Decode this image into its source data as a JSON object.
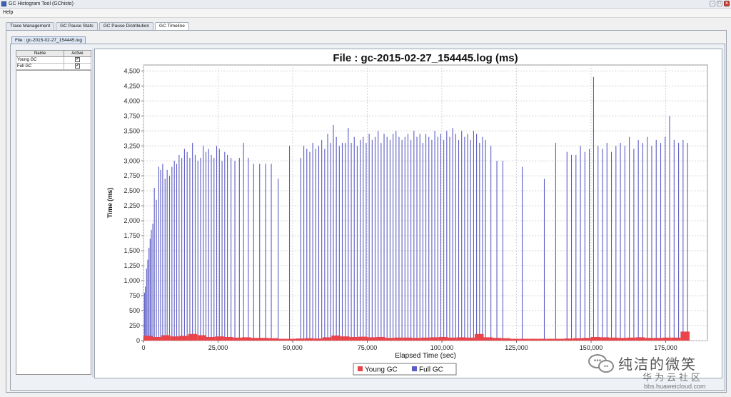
{
  "window": {
    "title": "GC Histogram Tool (GChisto)",
    "min": "–",
    "max": "□",
    "close": "✕"
  },
  "menu": {
    "help": "Help"
  },
  "tabs": [
    {
      "label": "Trace Management"
    },
    {
      "label": "GC Pause Stats"
    },
    {
      "label": "GC Pause Distribution"
    },
    {
      "label": "GC Timeline",
      "active": true
    }
  ],
  "file_tab": "File : gc-2015-02-27_154445.log",
  "series_table": {
    "headers": [
      "Name",
      "Active"
    ],
    "rows": [
      {
        "name": "Young GC",
        "active": true,
        "check": "✔"
      },
      {
        "name": "Full GC",
        "active": true,
        "check": "✔"
      }
    ]
  },
  "colors": {
    "young": "#e8444a",
    "full": "#5b5bc4",
    "grid": "#c0c0c0",
    "plot_bg": "#ffffff"
  },
  "chart_data": {
    "type": "bar",
    "title": "File : gc-2015-02-27_154445.log (ms)",
    "xlabel": "Elapsed Time (sec)",
    "ylabel": "Time (ms)",
    "xlim": [
      0,
      189000
    ],
    "ylim": [
      0,
      4600
    ],
    "x_ticks": [
      0,
      25000,
      50000,
      75000,
      100000,
      125000,
      150000,
      175000
    ],
    "x_tick_labels": [
      "0",
      "25,000",
      "50,000",
      "75,000",
      "100,000",
      "125,000",
      "150,000",
      "175,000"
    ],
    "y_ticks": [
      0,
      250,
      500,
      750,
      1000,
      1250,
      1500,
      1750,
      2000,
      2250,
      2500,
      2750,
      3000,
      3250,
      3500,
      3750,
      4000,
      4250,
      4500
    ],
    "y_tick_labels": [
      "0",
      "250",
      "500",
      "750",
      "1,000",
      "1,250",
      "1,500",
      "1,750",
      "2,000",
      "2,250",
      "2,500",
      "2,750",
      "3,000",
      "3,250",
      "3,500",
      "3,750",
      "4,000",
      "4,250",
      "4,500"
    ],
    "grid": true,
    "legend": "bottom-center",
    "series": [
      {
        "name": "Full GC",
        "color": "#5b5bc4",
        "x": [
          200,
          500,
          900,
          1300,
          1700,
          2100,
          2500,
          3000,
          3500,
          4200,
          5000,
          5600,
          6300,
          7100,
          7800,
          8600,
          9400,
          10200,
          11000,
          11800,
          12700,
          13600,
          14500,
          15400,
          16300,
          17200,
          18100,
          19000,
          19900,
          20800,
          21700,
          22600,
          23500,
          24400,
          25300,
          26200,
          27100,
          28000,
          29200,
          30500,
          32000,
          33400,
          35000,
          36800,
          38800,
          40800,
          42700,
          45000,
          48800,
          52600,
          53600,
          54600,
          55600,
          56600,
          57600,
          58600,
          59600,
          60600,
          61600,
          62600,
          63500,
          64500,
          65500,
          66500,
          67500,
          68500,
          69500,
          70500,
          71500,
          72500,
          73500,
          74500,
          75500,
          76500,
          77500,
          78500,
          79500,
          80500,
          81500,
          82500,
          83500,
          84500,
          85500,
          86500,
          87500,
          88500,
          89500,
          90500,
          91500,
          92500,
          93500,
          94500,
          95500,
          96500,
          97500,
          98500,
          99500,
          100500,
          101500,
          102500,
          103500,
          104500,
          105500,
          106500,
          107500,
          108500,
          109500,
          110500,
          111500,
          112500,
          113500,
          114500,
          116300,
          118300,
          120300,
          126800,
          134200,
          138000,
          141800,
          143300,
          144800,
          146300,
          147800,
          149300,
          150700,
          152200,
          153700,
          155200,
          156700,
          158200,
          159700,
          161200,
          162700,
          164200,
          165700,
          167200,
          168700,
          170200,
          171700,
          173200,
          174700,
          176200,
          177700,
          179200,
          180700,
          182200
        ],
        "values": [
          800,
          900,
          1200,
          1350,
          1550,
          1700,
          1850,
          1950,
          2550,
          2350,
          2900,
          2850,
          2950,
          2700,
          2850,
          2750,
          2900,
          3000,
          2950,
          3100,
          3050,
          3200,
          3150,
          3050,
          3300,
          3100,
          3000,
          3050,
          3250,
          3150,
          3200,
          3100,
          3050,
          3250,
          3200,
          3000,
          3150,
          3100,
          3050,
          3000,
          3050,
          3300,
          3050,
          2950,
          2950,
          2950,
          2950,
          2700,
          3250,
          3050,
          3250,
          3200,
          3150,
          3300,
          3200,
          3250,
          3350,
          3200,
          3450,
          3300,
          3600,
          3400,
          3250,
          3300,
          3300,
          3550,
          3300,
          3400,
          3250,
          3350,
          3400,
          3300,
          3450,
          3350,
          3400,
          3500,
          3300,
          3450,
          3400,
          3350,
          3450,
          3500,
          3400,
          3350,
          3400,
          3450,
          3350,
          3500,
          3400,
          3450,
          3300,
          3450,
          3400,
          3350,
          3500,
          3400,
          3450,
          3350,
          3500,
          3400,
          3550,
          3450,
          3350,
          3500,
          3400,
          3450,
          3350,
          3500,
          3450,
          3300,
          3400,
          3350,
          3250,
          3000,
          3000,
          2900,
          2700,
          3300,
          3150,
          3100,
          3100,
          3250,
          3150,
          3200,
          4400,
          3250,
          3200,
          3300,
          3150,
          3250,
          3300,
          3250,
          3400,
          3200,
          3350,
          3300,
          3400,
          3250,
          3350,
          3300,
          3400,
          3750,
          3350,
          3300,
          3350,
          3300
        ]
      },
      {
        "name": "Young GC",
        "color": "#e8444a",
        "x": [
          0,
          3000,
          6000,
          9000,
          12000,
          15000,
          18000,
          21000,
          24000,
          27000,
          30000,
          33000,
          36000,
          39000,
          42000,
          45000,
          48000,
          51000,
          54000,
          57000,
          60000,
          63000,
          66000,
          69000,
          72000,
          75000,
          78000,
          81000,
          84000,
          87000,
          90000,
          93000,
          96000,
          99000,
          102000,
          105000,
          108000,
          111000,
          114000,
          117000,
          120000,
          123000,
          126000,
          129000,
          132000,
          135000,
          138000,
          141000,
          144000,
          147000,
          150000,
          153000,
          156000,
          159000,
          162000,
          165000,
          168000,
          171000,
          174000,
          177000,
          180000
        ],
        "values": [
          80,
          60,
          90,
          70,
          80,
          110,
          90,
          60,
          70,
          60,
          50,
          55,
          45,
          45,
          40,
          30,
          30,
          35,
          40,
          35,
          55,
          85,
          70,
          60,
          65,
          55,
          60,
          45,
          50,
          50,
          45,
          50,
          55,
          60,
          50,
          55,
          50,
          110,
          55,
          45,
          40,
          30,
          30,
          30,
          30,
          30,
          30,
          35,
          40,
          45,
          60,
          55,
          50,
          45,
          50,
          55,
          45,
          45,
          50,
          50,
          150
        ]
      }
    ]
  },
  "watermark": {
    "brand": "纯洁的微笑",
    "sub": "华为云社区",
    "url": "bbs.huaweicloud.com",
    "logo_a": "•••",
    "logo_b": "••"
  }
}
